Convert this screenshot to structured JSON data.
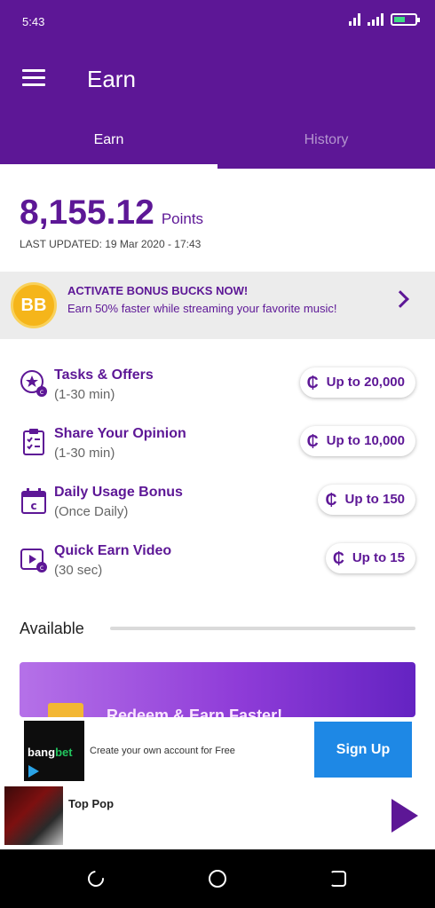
{
  "status": {
    "time": "5:43"
  },
  "appbar": {
    "title": "Earn"
  },
  "tabs": [
    {
      "label": "Earn",
      "active": true
    },
    {
      "label": "History",
      "active": false
    }
  ],
  "points": {
    "value": "8,155.12",
    "unit": "Points",
    "last_updated": "LAST UPDATED: 19 Mar 2020 - 17:43"
  },
  "promo": {
    "badge": "BB",
    "title": "ACTIVATE BONUS BUCKS NOW!",
    "subtitle": "Earn 50% faster while streaming your favorite music!"
  },
  "offers": [
    {
      "name": "Tasks & Offers",
      "duration": "(1-30 min)",
      "reward": "Up to 20,000",
      "icon": "star-coin-icon"
    },
    {
      "name": "Share Your Opinion",
      "duration": "(1-30 min)",
      "reward": "Up to 10,000",
      "icon": "clipboard-icon"
    },
    {
      "name": "Daily Usage Bonus",
      "duration": "(Once Daily)",
      "reward": "Up to 150",
      "icon": "calendar-icon"
    },
    {
      "name": "Quick Earn Video",
      "duration": "(30 sec)",
      "reward": "Up to 15",
      "icon": "video-coin-icon"
    }
  ],
  "currency_symbol": "₵",
  "available": {
    "label": "Available"
  },
  "redeem": {
    "text": "Redeem & Earn Faster!"
  },
  "ad": {
    "brand_part1": "bang",
    "brand_part2": "bet",
    "text": "Create your own account for Free",
    "cta": "Sign Up"
  },
  "player": {
    "song": "Top Pop"
  },
  "colors": {
    "primary": "#5d1796",
    "accent": "#1e88e5",
    "badge": "#f5b51a"
  }
}
